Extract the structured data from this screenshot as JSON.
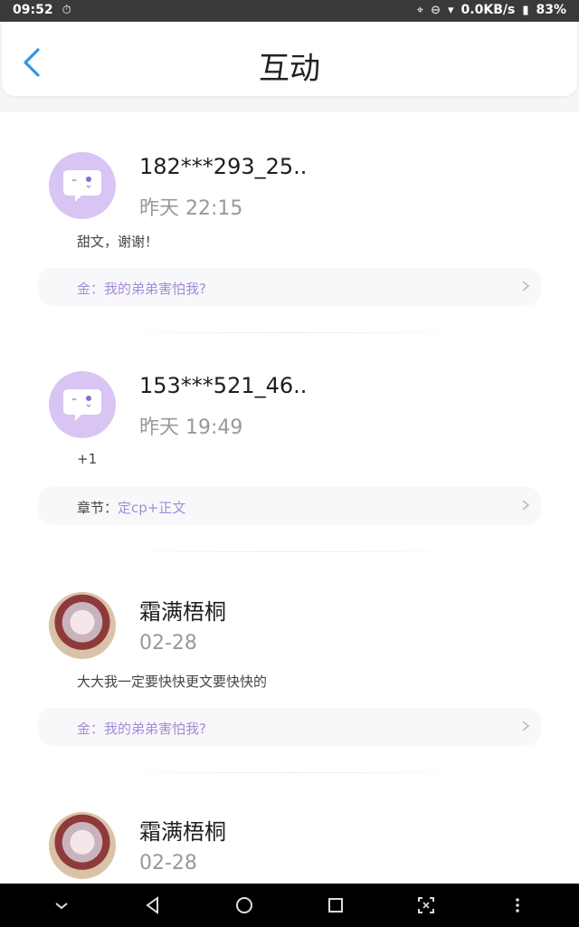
{
  "status_bar": {
    "time": "09:52",
    "speed": "0.0KB/s",
    "battery": "83%"
  },
  "header": {
    "title": "互动"
  },
  "items": [
    {
      "name": "182***293_25..",
      "time": "昨天 22:15",
      "comment": "甜文，谢谢！",
      "ref_prefix": "金：",
      "ref_text": "我的弟弟害怕我?"
    },
    {
      "name": "153***521_46..",
      "time": "昨天 19:49",
      "comment": "+1",
      "ref_prefix": "章节：",
      "ref_text": "定cp+正文"
    },
    {
      "name": "霜满梧桐",
      "time": "02-28",
      "comment": "大大我一定要快快更文要快快的",
      "ref_prefix": "金：",
      "ref_text": "我的弟弟害怕我?"
    },
    {
      "name": "霜满梧桐",
      "time": "02-28"
    }
  ],
  "colors": {
    "accent": "#2f97e8",
    "ref_text": "#a58ad8",
    "avatar_bg": "#d8c5f3"
  }
}
